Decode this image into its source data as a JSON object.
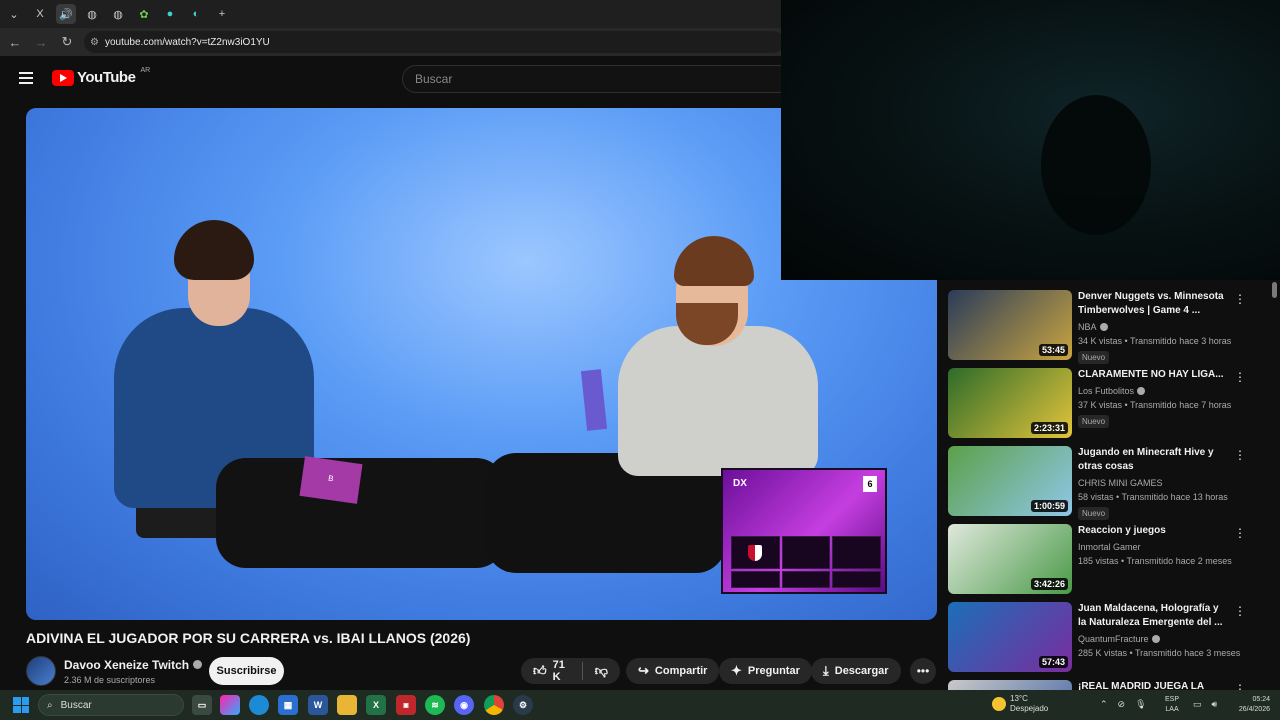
{
  "browser": {
    "url": "youtube.com/watch?v=tZ2nw3iO1YU",
    "tabs": [
      "X"
    ]
  },
  "header": {
    "logo_text": "YouTube",
    "region": "AR",
    "search_placeholder": "Buscar"
  },
  "video": {
    "title": "ADIVINA EL JUGADOR POR SU CARRERA vs. IBAI LLANOS (2026)",
    "overlay_label": "DX",
    "overlay_number": "6",
    "card_letter": "B"
  },
  "channel": {
    "name": "Davoo Xeneize Twitch",
    "subscribers": "2.36 M de suscriptores",
    "subscribe_label": "Suscribirse"
  },
  "actions": {
    "likes": "71 K",
    "share": "Compartir",
    "ask": "Preguntar",
    "download": "Descargar"
  },
  "recommendations": [
    {
      "title": "Denver Nuggets vs. Minnesota Timberwolves | Game 4 ...",
      "channel": "NBA",
      "verified": true,
      "meta": "34 K vistas • Transmitido hace 3 horas",
      "badge": "Nuevo",
      "duration": "53:45",
      "colors": [
        "#2a3c5a",
        "#c9a441"
      ]
    },
    {
      "title": "CLARAMENTE NO HAY LIGA...",
      "channel": "Los Futbolitos",
      "verified": true,
      "meta": "37 K vistas • Transmitido hace 7 horas",
      "badge": "Nuevo",
      "duration": "2:23:31",
      "colors": [
        "#2d6b2a",
        "#e3c43a"
      ]
    },
    {
      "title": "Jugando en Minecraft Hive y otras cosas",
      "channel": "CHRIS MINI GAMES",
      "verified": false,
      "meta": "58 vistas • Transmitido hace 13 horas",
      "badge": "Nuevo",
      "duration": "1:00:59",
      "colors": [
        "#5ca04a",
        "#8fc7e8"
      ]
    },
    {
      "title": "Reaccion y juegos",
      "channel": "Inmortal Gamer",
      "verified": false,
      "meta": "185 vistas • Transmitido hace 2 meses",
      "badge": "",
      "duration": "3:42:26",
      "colors": [
        "#dfe8dc",
        "#4a9a48"
      ]
    },
    {
      "title": "Juan Maldacena, Holografía y la Naturaleza Emergente del ...",
      "channel": "QuantumFracture",
      "verified": true,
      "meta": "285 K vistas • Transmitido hace 3 meses",
      "badge": "",
      "duration": "57:43",
      "colors": [
        "#1b6fb8",
        "#7b2c9e"
      ]
    },
    {
      "title": "¡REAL MADRID JUEGA LA",
      "channel": "",
      "verified": false,
      "meta": "",
      "badge": "",
      "duration": "",
      "colors": [
        "#c9c9c9",
        "#3a5fa0"
      ]
    }
  ],
  "taskbar": {
    "search_label": "Buscar",
    "temperature": "13°C",
    "weather": "Despejado",
    "lang_top": "ESP",
    "lang_bottom": "LAA",
    "time": "05:24",
    "date": "26/4/2026"
  }
}
